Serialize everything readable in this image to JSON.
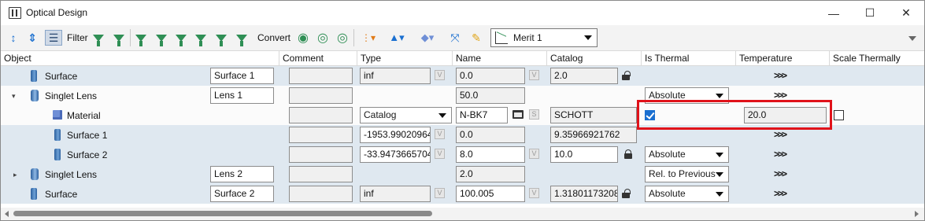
{
  "window": {
    "title": "Optical Design",
    "minimize": "—",
    "maximize": "☐",
    "close": "✕"
  },
  "toolbar": {
    "filter_label": "Filter",
    "convert_label": "Convert",
    "merit_select": "Merit 1"
  },
  "columns": [
    "Object",
    "Comment",
    "Type",
    "Name",
    "Catalog",
    "Is Thermal",
    "Temperature",
    "Scale Thermally"
  ],
  "rows": [
    {
      "label": "Surface",
      "name_col": "Surface 1",
      "type": "inf",
      "name": "0.0",
      "catalog": "2.0",
      "temperature": ">>>"
    },
    {
      "label": "Singlet Lens",
      "name_col": "Lens 1",
      "name": "50.0",
      "is_thermal": "Absolute",
      "temperature": ">>>"
    },
    {
      "label": "Material",
      "type": "Catalog",
      "name": "N-BK7",
      "s_badge": "S",
      "catalog": "SCHOTT",
      "is_thermal_checked": true,
      "temperature": "20.0",
      "scale_thermally_checked": false
    },
    {
      "label": "Surface 1",
      "type": "-1953.99020964",
      "name": "0.0",
      "catalog": "9.35966921762",
      "temperature": ">>>"
    },
    {
      "label": "Surface 2",
      "type": "-33.9473665704",
      "name": "8.0",
      "catalog": "10.0",
      "is_thermal": "Absolute",
      "temperature": ">>>"
    },
    {
      "label": "Singlet Lens",
      "name_col": "Lens 2",
      "name": "2.0",
      "is_thermal": "Rel. to Previous",
      "temperature": ">>>"
    },
    {
      "label": "Surface",
      "name_col": "Surface 2",
      "type": "inf",
      "name": "100.005",
      "catalog": "1.31801173208",
      "is_thermal": "Absolute",
      "temperature": ">>>"
    }
  ],
  "colors": {
    "row_blue": "#dfe8f0",
    "highlight": "#e0121a",
    "checkbox_accent": "#1a6fd0"
  },
  "icons": {
    "variable_button": "V"
  }
}
